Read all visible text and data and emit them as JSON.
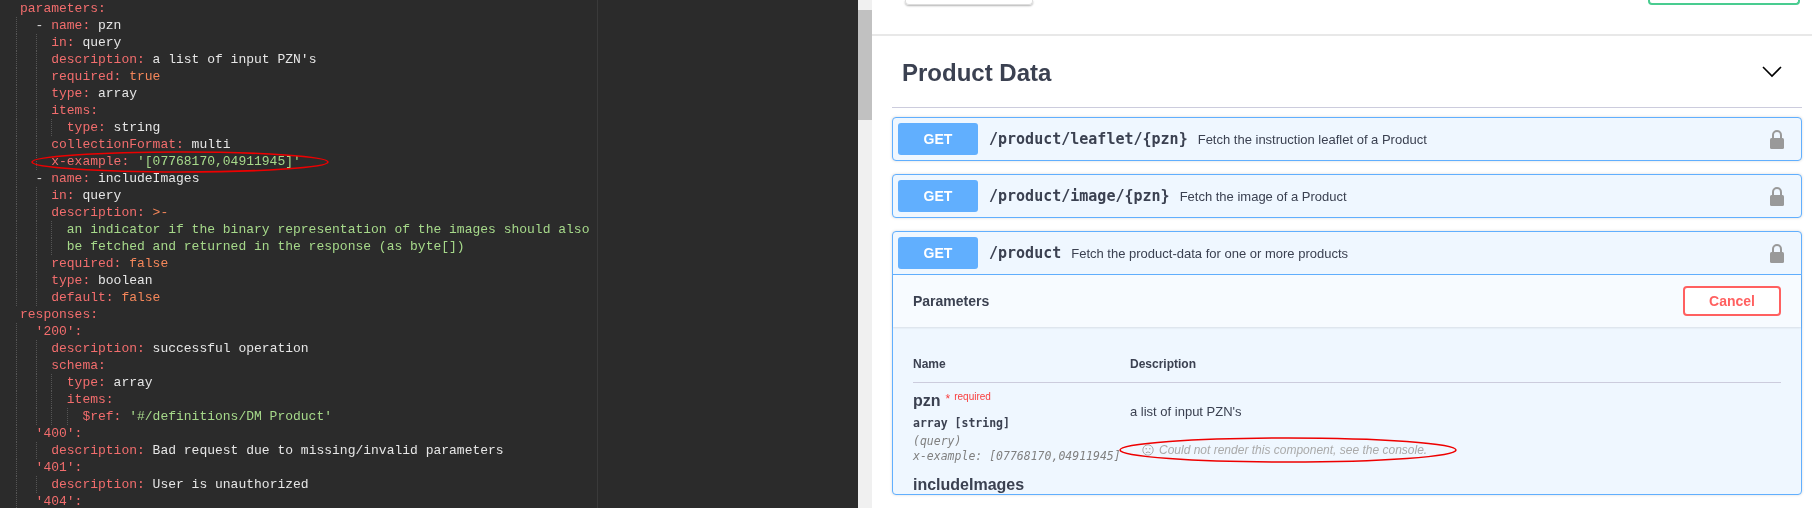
{
  "editor": {
    "lines": [
      {
        "tokens": [
          {
            "kind": "key",
            "text": "parameters:"
          }
        ],
        "children": [
          {
            "tokens": [
              {
                "kind": "dash",
                "text": "- "
              },
              {
                "kind": "key",
                "text": "name:"
              },
              {
                "kind": "text",
                "text": "pzn"
              }
            ],
            "children": [
              {
                "tokens": [
                  {
                    "kind": "key",
                    "text": "in:"
                  },
                  {
                    "kind": "text",
                    "text": "query"
                  }
                ]
              },
              {
                "tokens": [
                  {
                    "kind": "key",
                    "text": "description:"
                  },
                  {
                    "kind": "text",
                    "text": "a list of input PZN's"
                  }
                ]
              },
              {
                "tokens": [
                  {
                    "kind": "key",
                    "text": "required:"
                  },
                  {
                    "kind": "keyword",
                    "text": "true"
                  }
                ]
              },
              {
                "tokens": [
                  {
                    "kind": "key",
                    "text": "type:"
                  },
                  {
                    "kind": "text",
                    "text": "array"
                  }
                ]
              },
              {
                "tokens": [
                  {
                    "kind": "key",
                    "text": "items:"
                  }
                ],
                "children": [
                  {
                    "tokens": [
                      {
                        "kind": "key",
                        "text": "type:"
                      },
                      {
                        "kind": "text",
                        "text": "string"
                      }
                    ]
                  }
                ]
              },
              {
                "tokens": [
                  {
                    "kind": "key",
                    "text": "collectionFormat:"
                  },
                  {
                    "kind": "text",
                    "text": "multi"
                  }
                ]
              },
              {
                "tokens": [
                  {
                    "kind": "key",
                    "text": "x-example:"
                  },
                  {
                    "kind": "string",
                    "text": "'[07768170,04911945]'"
                  }
                ]
              }
            ]
          },
          {
            "tokens": [
              {
                "kind": "dash",
                "text": "- "
              },
              {
                "kind": "key",
                "text": "name:"
              },
              {
                "kind": "text",
                "text": "includeImages"
              }
            ],
            "children": [
              {
                "tokens": [
                  {
                    "kind": "key",
                    "text": "in:"
                  },
                  {
                    "kind": "text",
                    "text": "query"
                  }
                ]
              },
              {
                "tokens": [
                  {
                    "kind": "key",
                    "text": "description:"
                  },
                  {
                    "kind": "keyword",
                    "text": ">-"
                  }
                ],
                "children": [
                  {
                    "tokens": [
                      {
                        "kind": "string",
                        "text": "an indicator if the binary representation of the images should also"
                      }
                    ]
                  },
                  {
                    "tokens": [
                      {
                        "kind": "string",
                        "text": "be fetched and returned in the response (as byte[])"
                      }
                    ]
                  }
                ]
              },
              {
                "tokens": [
                  {
                    "kind": "key",
                    "text": "required:"
                  },
                  {
                    "kind": "keyword",
                    "text": "false"
                  }
                ]
              },
              {
                "tokens": [
                  {
                    "kind": "key",
                    "text": "type:"
                  },
                  {
                    "kind": "text",
                    "text": "boolean"
                  }
                ]
              },
              {
                "tokens": [
                  {
                    "kind": "key",
                    "text": "default:"
                  },
                  {
                    "kind": "keyword",
                    "text": "false"
                  }
                ]
              }
            ]
          }
        ]
      },
      {
        "tokens": [
          {
            "kind": "key",
            "text": "responses:"
          }
        ],
        "children": [
          {
            "tokens": [
              {
                "kind": "key",
                "text": "'200':"
              }
            ],
            "children": [
              {
                "tokens": [
                  {
                    "kind": "key",
                    "text": "description:"
                  },
                  {
                    "kind": "text",
                    "text": "successful operation"
                  }
                ]
              },
              {
                "tokens": [
                  {
                    "kind": "key",
                    "text": "schema:"
                  }
                ],
                "children": [
                  {
                    "tokens": [
                      {
                        "kind": "key",
                        "text": "type:"
                      },
                      {
                        "kind": "text",
                        "text": "array"
                      }
                    ]
                  },
                  {
                    "tokens": [
                      {
                        "kind": "key",
                        "text": "items:"
                      }
                    ],
                    "children": [
                      {
                        "tokens": [
                          {
                            "kind": "key",
                            "text": "$ref:"
                          },
                          {
                            "kind": "string",
                            "text": "'#/definitions/DM Product'"
                          }
                        ]
                      }
                    ]
                  }
                ]
              }
            ]
          },
          {
            "tokens": [
              {
                "kind": "key",
                "text": "'400':"
              }
            ],
            "children": [
              {
                "tokens": [
                  {
                    "kind": "key",
                    "text": "description:"
                  },
                  {
                    "kind": "text",
                    "text": "Bad request due to missing/invalid parameters"
                  }
                ]
              }
            ]
          },
          {
            "tokens": [
              {
                "kind": "key",
                "text": "'401':"
              }
            ],
            "children": [
              {
                "tokens": [
                  {
                    "kind": "key",
                    "text": "description:"
                  },
                  {
                    "kind": "text",
                    "text": "User is unauthorized"
                  }
                ]
              }
            ]
          },
          {
            "tokens": [
              {
                "kind": "key",
                "text": "'404':"
              }
            ]
          }
        ]
      }
    ]
  },
  "section": {
    "title": "Product Data",
    "expanded": true,
    "operations": [
      {
        "method": "GET",
        "path": "/product/leaflet/{pzn}",
        "summary": "Fetch the instruction leaflet of a Product",
        "expanded": false
      },
      {
        "method": "GET",
        "path": "/product/image/{pzn}",
        "summary": "Fetch the image of a Product",
        "expanded": false
      },
      {
        "method": "GET",
        "path": "/product",
        "summary": "Fetch the product-data for one or more products",
        "expanded": true
      }
    ],
    "parameters_panel": {
      "title": "Parameters",
      "cancel": "Cancel",
      "columns": [
        "Name",
        "Description"
      ],
      "rows": [
        {
          "name": "pzn",
          "required_mark": "*",
          "required": "required",
          "type": "array [string]",
          "in": "(query)",
          "example": "x-example: [07768170,04911945]",
          "description": "a list of input PZN's",
          "error": "Could not render this component, see the console."
        },
        {
          "name": "includeImages"
        }
      ]
    }
  }
}
